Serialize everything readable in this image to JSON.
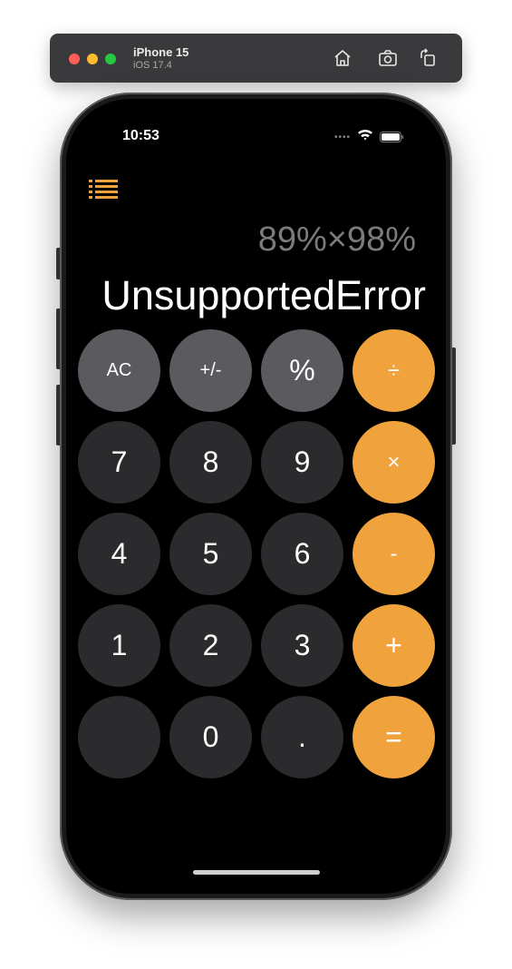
{
  "simulator": {
    "device_name": "iPhone 15",
    "os_version": "iOS 17.4",
    "toolbar_icons": [
      "home-icon",
      "screenshot-icon",
      "rotate-icon"
    ]
  },
  "status_bar": {
    "time": "10:53",
    "dots": "••••",
    "icons": [
      "wifi-icon",
      "battery-icon"
    ]
  },
  "history_button": {
    "icon": "list-icon"
  },
  "display": {
    "expression": "89%×98%",
    "result": "UnsupportedError"
  },
  "keypad": {
    "row1": [
      "AC",
      "+/-",
      "%",
      "÷"
    ],
    "row2": [
      "7",
      "8",
      "9",
      "×"
    ],
    "row3": [
      "4",
      "5",
      "6",
      "-"
    ],
    "row4": [
      "1",
      "2",
      "3",
      "+"
    ],
    "row5": [
      "",
      "0",
      ".",
      "="
    ]
  },
  "colors": {
    "function_key": "#5b5b5f",
    "number_key": "#2b2b2d",
    "operator_key": "#f0a23c",
    "accent": "#f0a23c",
    "background": "#000000"
  }
}
